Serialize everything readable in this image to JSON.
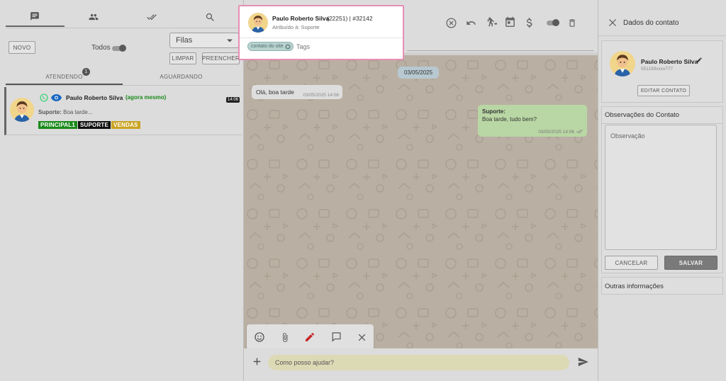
{
  "left": {
    "novo_label": "NOVO",
    "todos_label": "Todos",
    "filas_label": "Filas",
    "limpar_label": "LIMPAR",
    "preencher_label": "PREENCHER",
    "tab_atendendo": "ATENDENDO",
    "tab_aguardando": "AGUARDANDO",
    "atendendo_count": "1",
    "ticket": {
      "name": "Paulo Roberto Silva",
      "time_ago": "(agora mesmo)",
      "time": "14:06",
      "last_message_sender": "Suporte:",
      "last_message": "Boa tarde...",
      "tags": [
        {
          "label": "PRINCIPAL1",
          "color": "#1a8a1a"
        },
        {
          "label": "SUPORTE",
          "color": "#111111"
        },
        {
          "label": "VENDAS",
          "color": "#c9a323"
        }
      ]
    }
  },
  "header": {
    "contact_name": "Paulo Roberto Silva",
    "ticket_ref": "(22251) | #32142",
    "assigned": "Atribuído à: Suporte",
    "tag_chip": "contato do site",
    "tags_placeholder": "Tags"
  },
  "chat": {
    "date_chip": "03/05/2025",
    "incoming": {
      "text": "Olá, boa tarde",
      "time": "03/05/2025 14:06"
    },
    "outgoing": {
      "sender": "Suporte:",
      "text": "Boa tarde, tudo bem?",
      "time": "03/05/2025 14:06"
    },
    "input_value": "Como posso ajudar?"
  },
  "right": {
    "title": "Dados do contato",
    "contact_name": "Paulo Roberto Silva",
    "phone": "551199xxxx777",
    "edit_label": "EDITAR CONTATO",
    "obs_title": "Observações do Contato",
    "obs_placeholder": "Observação",
    "cancel_label": "CANCELAR",
    "save_label": "SALVAR",
    "other_info": "Outras informações"
  },
  "colors": {
    "accent_pink": "#e68fb4",
    "whatsapp_green": "#25d366",
    "eye_blue": "#1565c0"
  }
}
